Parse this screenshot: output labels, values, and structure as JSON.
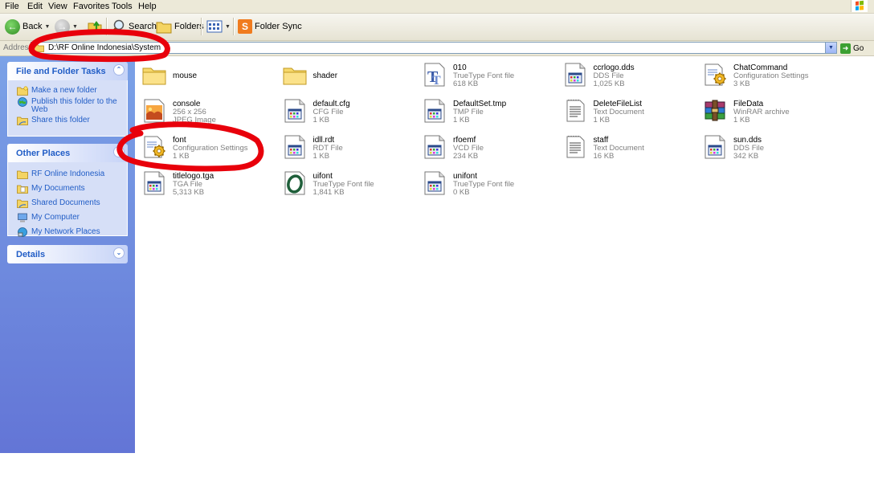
{
  "menu": [
    "File",
    "Edit",
    "View",
    "Favorites",
    "Tools",
    "Help"
  ],
  "toolbar": {
    "back_label": "Back",
    "search_label": "Search",
    "folders_label": "Folders",
    "folder_sync_label": "Folder Sync"
  },
  "address": {
    "label": "Address",
    "path": "D:\\RF Online Indonesia\\System",
    "go_label": "Go"
  },
  "sidebar": {
    "file_tasks": {
      "title": "File and Folder Tasks",
      "items": [
        {
          "label": "Make a new folder",
          "icon": "new-folder-icon"
        },
        {
          "label": "Publish this folder to the Web",
          "icon": "globe-icon"
        },
        {
          "label": "Share this folder",
          "icon": "share-folder-icon"
        }
      ]
    },
    "other_places": {
      "title": "Other Places",
      "items": [
        {
          "label": "RF Online Indonesia",
          "icon": "folder-icon"
        },
        {
          "label": "My Documents",
          "icon": "documents-icon"
        },
        {
          "label": "Shared Documents",
          "icon": "shared-documents-icon"
        },
        {
          "label": "My Computer",
          "icon": "computer-icon"
        },
        {
          "label": "My Network Places",
          "icon": "network-icon"
        }
      ]
    },
    "details": {
      "title": "Details"
    }
  },
  "files": [
    {
      "name": "mouse",
      "type": "",
      "size": "",
      "icon": "folder-icon"
    },
    {
      "name": "shader",
      "type": "",
      "size": "",
      "icon": "folder-icon"
    },
    {
      "name": "010",
      "type": "TrueType Font file",
      "size": "618 KB",
      "icon": "truetype-icon"
    },
    {
      "name": "ccrlogo.dds",
      "type": "DDS File",
      "size": "1,025 KB",
      "icon": "generic-file-icon"
    },
    {
      "name": "ChatCommand",
      "type": "Configuration Settings",
      "size": "3 KB",
      "icon": "config-icon"
    },
    {
      "name": "console",
      "type": "256 x 256",
      "size": "JPEG Image",
      "icon": "jpeg-icon"
    },
    {
      "name": "default.cfg",
      "type": "CFG File",
      "size": "1 KB",
      "icon": "generic-file-icon"
    },
    {
      "name": "DefaultSet.tmp",
      "type": "TMP File",
      "size": "1 KB",
      "icon": "generic-file-icon"
    },
    {
      "name": "DeleteFileList",
      "type": "Text Document",
      "size": "1 KB",
      "icon": "text-doc-icon"
    },
    {
      "name": "FileData",
      "type": "WinRAR archive",
      "size": "1 KB",
      "icon": "winrar-icon"
    },
    {
      "name": "font",
      "type": "Configuration Settings",
      "size": "1 KB",
      "icon": "config-icon"
    },
    {
      "name": "idll.rdt",
      "type": "RDT File",
      "size": "1 KB",
      "icon": "generic-file-icon"
    },
    {
      "name": "rfoemf",
      "type": "VCD File",
      "size": "234 KB",
      "icon": "generic-file-icon"
    },
    {
      "name": "staff",
      "type": "Text Document",
      "size": "16 KB",
      "icon": "text-doc-icon"
    },
    {
      "name": "sun.dds",
      "type": "DDS File",
      "size": "342 KB",
      "icon": "generic-file-icon"
    },
    {
      "name": "titlelogo.tga",
      "type": "TGA File",
      "size": "5,313 KB",
      "icon": "generic-file-icon"
    },
    {
      "name": "uifont",
      "type": "TrueType Font file",
      "size": "1,841 KB",
      "icon": "opentype-icon"
    },
    {
      "name": "unifont",
      "type": "TrueType Font file",
      "size": "0 KB",
      "icon": "generic-file-icon"
    }
  ],
  "colors": {
    "taskpane_top": "#7ba2e7",
    "taskpane_bottom": "#6375d6",
    "link": "#215dc6",
    "annotation": "#e8000b"
  }
}
